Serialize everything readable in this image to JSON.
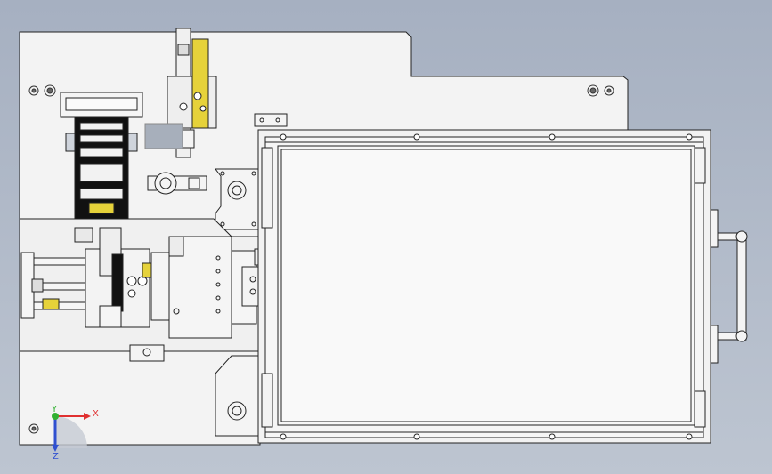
{
  "viewport": {
    "background_top": "#a9b3c3",
    "background_bottom": "#b9c2cf",
    "part_fill": "#f2f2f2",
    "edge_color": "#202020",
    "highlight_yellow": "#e6d23a",
    "dark_block": "#1a1a1a"
  },
  "triad": {
    "x_label": "X",
    "y_label": "Y",
    "z_label": "Z",
    "x_color": "#e03030",
    "y_color": "#30b030",
    "z_color": "#3050d0"
  }
}
